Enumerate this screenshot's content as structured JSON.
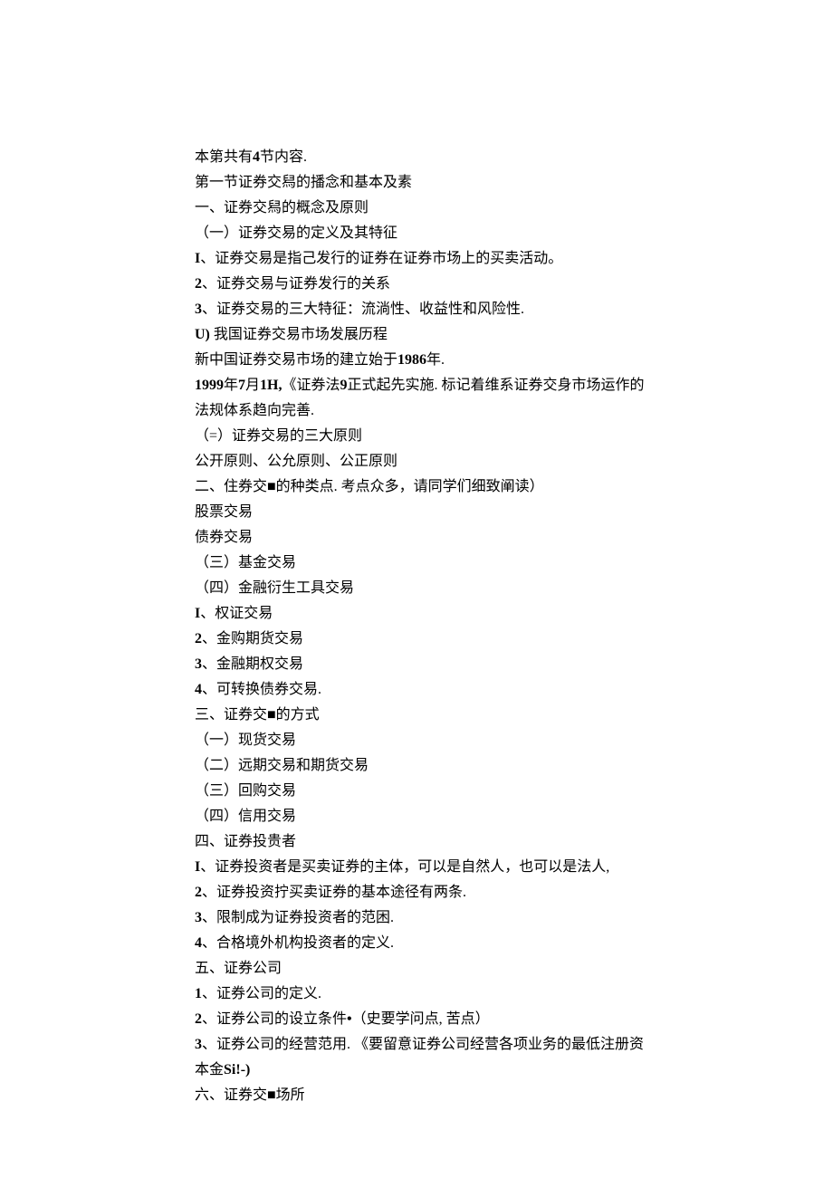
{
  "lines": [
    {
      "text": "本第共有4节内容.",
      "bold_chars": [
        "4"
      ]
    },
    {
      "text": "第一节证券交舄的播念和基本及素"
    },
    {
      "text": "一、证券交舄的概念及原则"
    },
    {
      "text": "（一）证券交易的定义及其特征"
    },
    {
      "text": "I、证券交易是指己发行的证券在证券市场上的买卖活动。",
      "bold_chars": [
        "I"
      ]
    },
    {
      "text": "2、证券交易与证券发行的关系",
      "bold_chars": [
        "2"
      ]
    },
    {
      "text": "3、证券交易的三大特征：流淌性、收益性和风险性.",
      "bold_chars": [
        "3"
      ]
    },
    {
      "text": "U) 我国证券交易市场发展历程",
      "bold_chars": [
        "U)"
      ]
    },
    {
      "text": "新中国证券交易市场的建立始于1986年.",
      "bold_chars": [
        "1986"
      ]
    },
    {
      "text": "1999年7月1H,《证券法9正式起先实施. 标记着维系证券交身市场运作的法规体系趋向完善.",
      "bold_chars": [
        "1999",
        "7",
        "1H,",
        "9"
      ]
    },
    {
      "text": "（=）证券交易的三大原则"
    },
    {
      "text": "公开原则、公允原则、公正原则"
    },
    {
      "text": "二、住券交■的种类点. 考点众多，请同学们细致阐读）"
    },
    {
      "text": "股票交易"
    },
    {
      "text": "债券交易"
    },
    {
      "text": "（三）基金交易"
    },
    {
      "text": "（四）金融衍生工具交易"
    },
    {
      "text": "I、权证交易",
      "bold_chars": [
        "I"
      ]
    },
    {
      "text": "2、金购期货交易",
      "bold_chars": [
        "2"
      ]
    },
    {
      "text": "3、金融期权交易",
      "bold_chars": [
        "3"
      ]
    },
    {
      "text": "4、可转换债券交易.",
      "bold_chars": [
        "4"
      ]
    },
    {
      "text": "三、证券交■的方式"
    },
    {
      "text": "（一）现货交易"
    },
    {
      "text": "（二）远期交易和期货交易"
    },
    {
      "text": "（三）回购交易"
    },
    {
      "text": "（四）信用交易"
    },
    {
      "text": "四、证券投贵者"
    },
    {
      "text": "I、证券投资者是买卖证券的主体，可以是自然人，也可以是法人,",
      "bold_chars": [
        "I"
      ]
    },
    {
      "text": "2、证券投资拧买卖证券的基本途径有两条.",
      "bold_chars": [
        "2"
      ]
    },
    {
      "text": "3、限制成为证券投资者的范困.",
      "bold_chars": [
        "3"
      ]
    },
    {
      "text": "4、合格境外机构投资者的定义.",
      "bold_chars": [
        "4"
      ]
    },
    {
      "text": "五、证券公司"
    },
    {
      "text": "1、证券公司的定义.",
      "bold_chars": [
        "1"
      ]
    },
    {
      "text": "2、证券公司的设立条件•（史要学问点, 苦点）",
      "bold_chars": [
        "2",
        "•"
      ]
    },
    {
      "text": "3、证券公司的经营范用. 《要留意证券公司经营各项业务的最低注册资本金Si!-)",
      "bold_chars": [
        "3",
        "Si!-",
        ")"
      ]
    },
    {
      "text": "六、证券交■场所"
    }
  ]
}
